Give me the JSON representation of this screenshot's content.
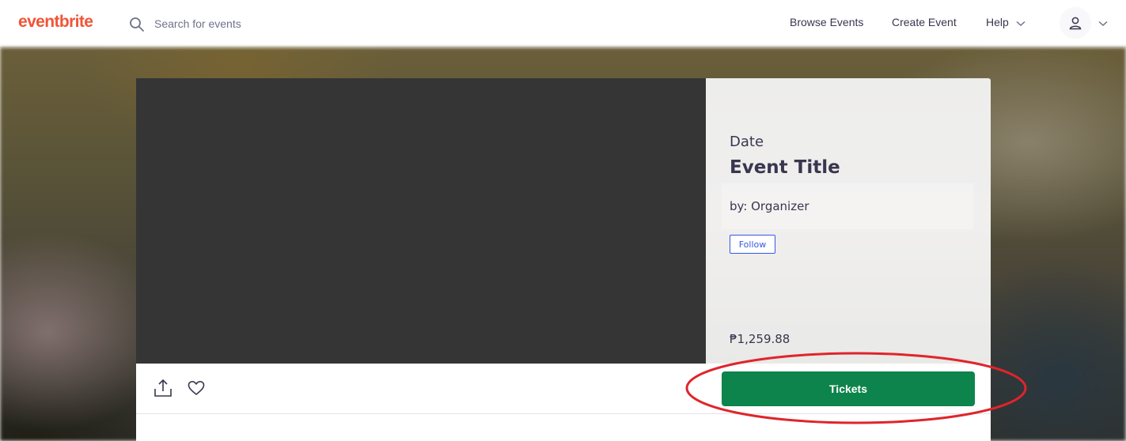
{
  "header": {
    "logo": "eventbrite",
    "search_placeholder": "Search for events",
    "nav": {
      "browse_events": "Browse Events",
      "create_event": "Create Event",
      "help": "Help"
    }
  },
  "event": {
    "date": "Date",
    "title": "Event Title",
    "organizer": "by: Organizer",
    "follow_label": "Follow",
    "price": "₱1,259.88",
    "tickets_label": "Tickets"
  },
  "colors": {
    "brand": "#f05537",
    "tickets_green": "#0d844b",
    "follow_blue": "#3659e3",
    "annotation_red": "#e0242b"
  },
  "icons": [
    "search-icon",
    "chevron-down-icon",
    "user-icon",
    "share-icon",
    "heart-icon"
  ]
}
